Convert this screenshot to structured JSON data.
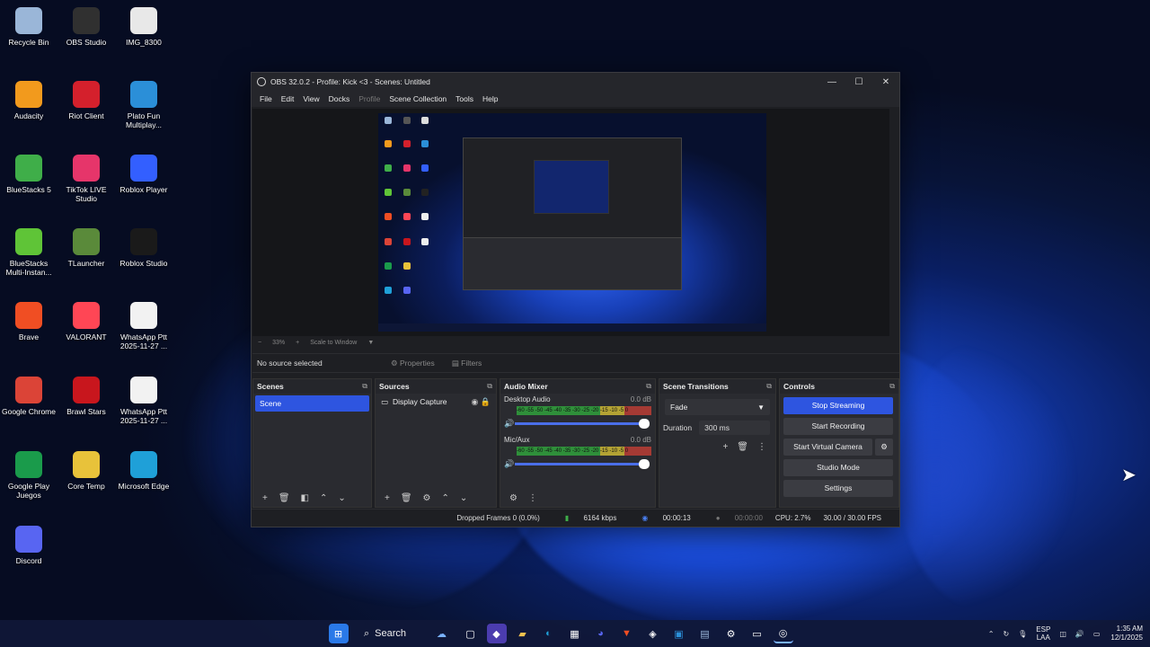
{
  "desktop_icons": [
    {
      "label": "Recycle Bin",
      "icon": "recycle-bin-icon",
      "color": "#9ab6d8"
    },
    {
      "label": "OBS Studio",
      "icon": "obs-icon",
      "color": "#303030"
    },
    {
      "label": "IMG_8300",
      "icon": "image-file-icon",
      "color": "#e8e8e8"
    },
    {
      "label": "Audacity",
      "icon": "audacity-icon",
      "color": "#f29a1d"
    },
    {
      "label": "Riot Client",
      "icon": "riot-icon",
      "color": "#d4202c"
    },
    {
      "label": "Plato Fun Multiplay...",
      "icon": "plato-icon",
      "color": "#2b8fd8"
    },
    {
      "label": "BlueStacks 5",
      "icon": "bluestacks-icon",
      "color": "#3fae49"
    },
    {
      "label": "TikTok LIVE Studio",
      "icon": "tiktok-icon",
      "color": "#e6356a"
    },
    {
      "label": "Roblox Player",
      "icon": "roblox-player-icon",
      "color": "#335fff"
    },
    {
      "label": "BlueStacks Multi-Instan...",
      "icon": "bluestacks-multi-icon",
      "color": "#5fc437"
    },
    {
      "label": "TLauncher",
      "icon": "tlauncher-icon",
      "color": "#5a8a3a"
    },
    {
      "label": "Roblox Studio",
      "icon": "roblox-studio-icon",
      "color": "#1a1a1a"
    },
    {
      "label": "Brave",
      "icon": "brave-icon",
      "color": "#f04e23"
    },
    {
      "label": "VALORANT",
      "icon": "valorant-icon",
      "color": "#ff4655"
    },
    {
      "label": "WhatsApp Ptt 2025-11-27 ...",
      "icon": "video-file-icon",
      "color": "#f2f2f2"
    },
    {
      "label": "Google Chrome",
      "icon": "chrome-icon",
      "color": "#db4437"
    },
    {
      "label": "Brawl Stars",
      "icon": "brawl-stars-icon",
      "color": "#c8161d"
    },
    {
      "label": "WhatsApp Ptt 2025-11-27 ...",
      "icon": "video-file-icon",
      "color": "#f2f2f2"
    },
    {
      "label": "Google Play Juegos",
      "icon": "google-play-games-icon",
      "color": "#1a9b4b"
    },
    {
      "label": "Core Temp",
      "icon": "core-temp-icon",
      "color": "#e8c23a"
    },
    {
      "label": "Microsoft Edge",
      "icon": "edge-icon",
      "color": "#1fa0d8"
    },
    {
      "label": "Discord",
      "icon": "discord-icon",
      "color": "#5865f2"
    }
  ],
  "obs": {
    "title": "OBS 32.0.2 - Profile: Kick <3 - Scenes: Untitled",
    "menu": [
      "File",
      "Edit",
      "View",
      "Docks",
      "Profile",
      "Scene Collection",
      "Tools",
      "Help"
    ],
    "zoom": "33%",
    "scale_mode": "Scale to Window",
    "no_source": "No source selected",
    "properties_label": "Properties",
    "filters_label": "Filters",
    "scenes_title": "Scenes",
    "scenes": [
      "Scene"
    ],
    "sources_title": "Sources",
    "sources": [
      "Display Capture"
    ],
    "mixer_title": "Audio Mixer",
    "channels": [
      {
        "name": "Desktop Audio",
        "db": "0.0 dB"
      },
      {
        "name": "Mic/Aux",
        "db": "0.0 dB"
      }
    ],
    "meter_ticks": "-60 -55 -50 -45 -40 -35 -30 -25 -20 -15 -10 -5 0",
    "transitions_title": "Scene Transitions",
    "transition": "Fade",
    "duration_label": "Duration",
    "duration_value": "300 ms",
    "controls_title": "Controls",
    "controls": {
      "stop_streaming": "Stop Streaming",
      "start_recording": "Start Recording",
      "start_virtual_camera": "Start Virtual Camera",
      "studio_mode": "Studio Mode",
      "settings": "Settings"
    },
    "status": {
      "dropped": "Dropped Frames 0 (0.0%)",
      "bitrate": "6164 kbps",
      "stream_time": "00:00:13",
      "rec_time": "00:00:00",
      "cpu": "CPU: 2.7%",
      "fps": "30.00 / 30.00 FPS"
    }
  },
  "taskbar": {
    "search_label": "Search",
    "lang_line1": "ESP",
    "lang_line2": "LAA",
    "time": "1:35 AM",
    "date": "12/1/2025"
  },
  "colors": {
    "accent": "#2e55e0",
    "panel": "#2a2b30",
    "window": "#1e1f23"
  }
}
